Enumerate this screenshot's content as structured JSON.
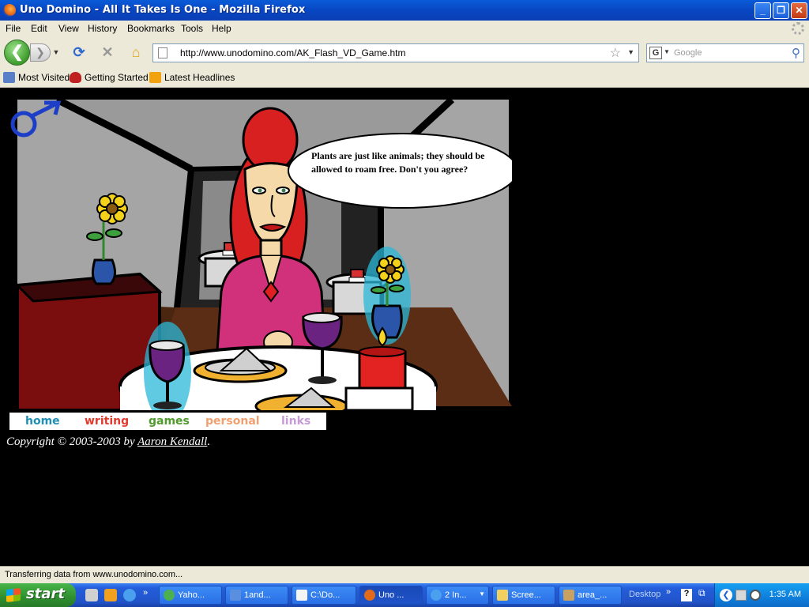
{
  "window": {
    "title": "Uno Domino - All It Takes Is One - Mozilla Firefox"
  },
  "menu": [
    "File",
    "Edit",
    "View",
    "History",
    "Bookmarks",
    "Tools",
    "Help"
  ],
  "address": {
    "url": "http://www.unodomino.com/AK_Flash_VD_Game.htm"
  },
  "search": {
    "engine_glyph": "G",
    "placeholder": "Google"
  },
  "bookmarks": [
    "Most Visited",
    "Getting Started",
    "Latest Headlines"
  ],
  "page": {
    "speech": "Plants are just like animals;  they should be allowed to roam free.  Don't you agree?",
    "nav_links": [
      {
        "label": "home",
        "color": "#1e8fb5"
      },
      {
        "label": "writing",
        "color": "#e23a2e"
      },
      {
        "label": "games",
        "color": "#4f9a2a"
      },
      {
        "label": "personal",
        "color": "#f0a070"
      },
      {
        "label": "links",
        "color": "#c79ad8"
      }
    ],
    "copyright_prefix": "Copyright © 2003-2003 by ",
    "copyright_author": "Aaron Kendall",
    "copyright_suffix": "."
  },
  "status": {
    "text": "Transferring data from www.unodomino.com..."
  },
  "taskbar": {
    "start_label": "start",
    "tasks": [
      "Yaho...",
      "1and...",
      "C:\\Do...",
      "Uno ...",
      "2 In...",
      "Scree...",
      "area_..."
    ],
    "desktop_label": "Desktop",
    "clock": "1:35 AM"
  },
  "colors": {
    "xp_blue": "#0a5bd8",
    "chrome": "#ece9d8",
    "wall_gray": "#9a9a9a",
    "tablecloth": "#ffffff",
    "shirt": "#d0317a"
  }
}
